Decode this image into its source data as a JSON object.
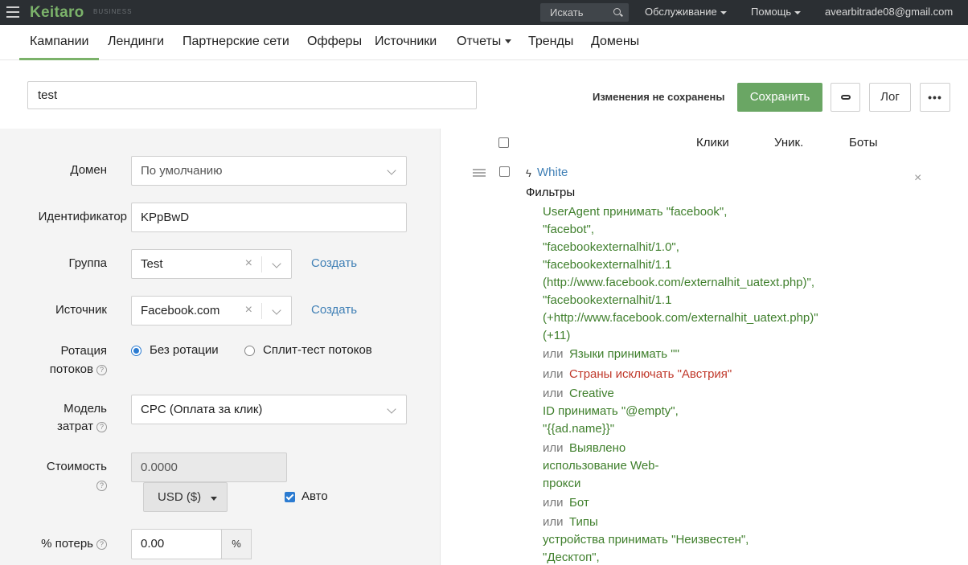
{
  "topbar": {
    "logo": "Keitaro",
    "logo_sub": "BUSINESS",
    "search_placeholder": "Искать",
    "maintenance": "Обслуживание",
    "help": "Помощь",
    "account": "avearbitrade08@gmail.com"
  },
  "nav": {
    "items": [
      "Кампании",
      "Лендинги",
      "Партнерские сети",
      "Офферы",
      "Источники",
      "Отчеты",
      "Тренды",
      "Домены"
    ]
  },
  "header": {
    "campaign_name": "test",
    "unsaved": "Изменения не сохранены",
    "save": "Сохранить",
    "log": "Лог",
    "more": "•••"
  },
  "form": {
    "domain_label": "Домен",
    "domain_value": "По умолчанию",
    "id_label": "Идентификатор",
    "id_value": "KPpBwD",
    "group_label": "Группа",
    "group_value": "Test",
    "source_label": "Источник",
    "source_value": "Facebook.com",
    "create": "Создать",
    "rotation_label_1": "Ротация",
    "rotation_label_2": "потоков",
    "rotation_opt1": "Без ротации",
    "rotation_opt2": "Сплит-тест потоков",
    "cost_model_label_1": "Модель",
    "cost_model_label_2": "затрат",
    "cost_model_value": "CPC (Оплата за клик)",
    "cost_label": "Стоимость",
    "cost_value": "0.0000",
    "currency": "USD ($)",
    "auto": "Авто",
    "loss_label": "% потерь",
    "loss_value": "0.00",
    "loss_addon": "%",
    "help_mark": "?"
  },
  "streams": {
    "columns": [
      "Клики",
      "Уник.",
      "Боты"
    ],
    "stream_name": "White",
    "filters_heading": "Фильтры",
    "lines": [
      "UserAgent принимать \"facebook\",",
      "\"facebot\",",
      "\"facebookexternalhit/1.0\",",
      "\"facebookexternalhit/1.1",
      "(http://www.facebook.com/externalhit_uatext.php)\",",
      "\"facebookexternalhit/1.1",
      "(+http://www.facebook.com/externalhit_uatext.php)\"",
      "(+11)"
    ],
    "or": "или",
    "langs": "Языки принимать \"\"",
    "countries": "Страны исключать \"Австрия\"",
    "creative_1": "Creative",
    "creative_2": "ID принимать \"@empty\",",
    "creative_3": "\"{{ad.name}}\"",
    "proxy_1": "Выявлено",
    "proxy_2": "использование Web-",
    "proxy_3": "прокси",
    "bot": "Бот",
    "device_1": "Типы",
    "device_2": "устройства принимать \"Неизвестен\",",
    "device_3": "\"Десктоп\","
  }
}
